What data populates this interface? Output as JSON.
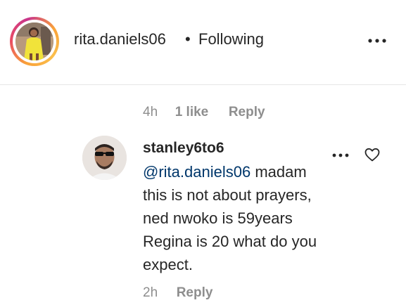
{
  "post_header": {
    "username": "rita.daniels06",
    "separator": "•",
    "follow_status": "Following",
    "more_icon": "more-horizontal-icon"
  },
  "parent_comment_meta": {
    "time": "4h",
    "likes": "1 like",
    "reply": "Reply"
  },
  "reply_comment": {
    "username": "stanley6to6",
    "mention": "@rita.daniels06",
    "text": " madam this is not about prayers, ned nwoko is 59years Regina is 20 what do you expect.",
    "more_icon": "more-horizontal-icon",
    "like_icon": "heart-outline-icon",
    "meta": {
      "time": "2h",
      "reply": "Reply"
    }
  },
  "colors": {
    "text": "#262626",
    "secondary": "#8e8e8e",
    "mention": "#00376b",
    "divider": "#e6e6e6"
  }
}
